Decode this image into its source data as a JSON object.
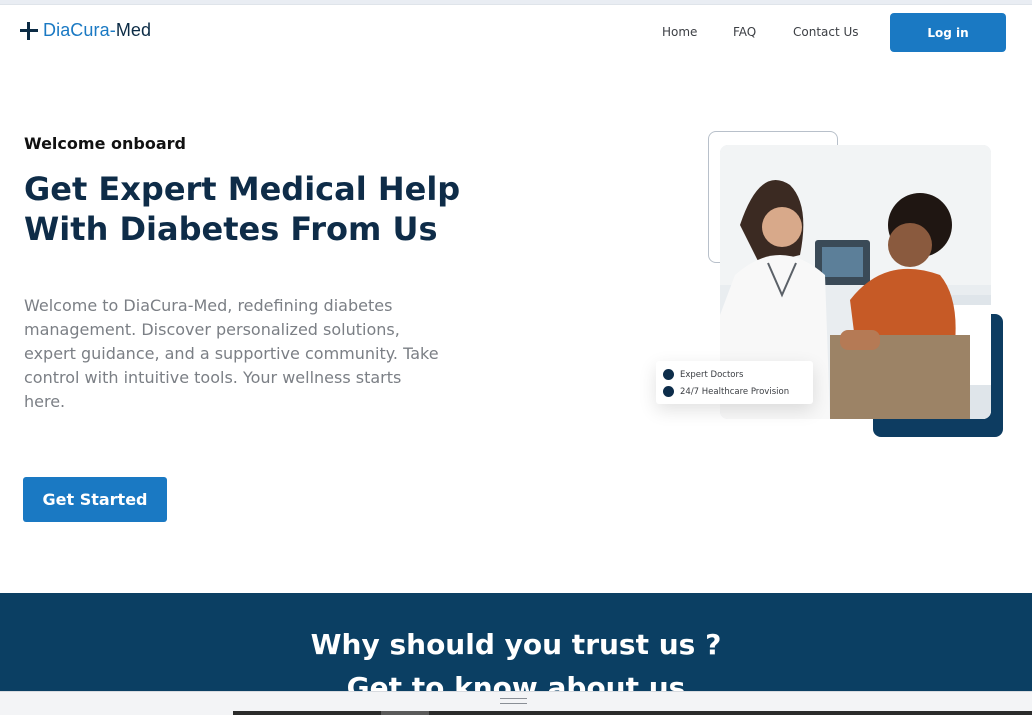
{
  "brand": {
    "name_part1": "DiaCura-",
    "name_part2": "Med",
    "logo_icon": "plus-cross-icon"
  },
  "nav": {
    "home": "Home",
    "faq": "FAQ",
    "contact": "Contact Us",
    "login": "Log in"
  },
  "hero": {
    "eyebrow": "Welcome onboard",
    "headline": "Get Expert Medical Help With Diabetes From Us",
    "intro": "Welcome to DiaCura-Med, redefining diabetes management. Discover personalized solutions, expert guidance, and a supportive community. Take control with intuitive tools. Your wellness starts here.",
    "cta": "Get Started",
    "features": [
      "Expert Doctors",
      "24/7 Healthcare Provision"
    ]
  },
  "trust": {
    "title": "Why should you trust us ?",
    "subtitle": "Get to know about us"
  },
  "colors": {
    "primary": "#1a79c3",
    "navy": "#0b3f63",
    "heading": "#0e2c48"
  }
}
